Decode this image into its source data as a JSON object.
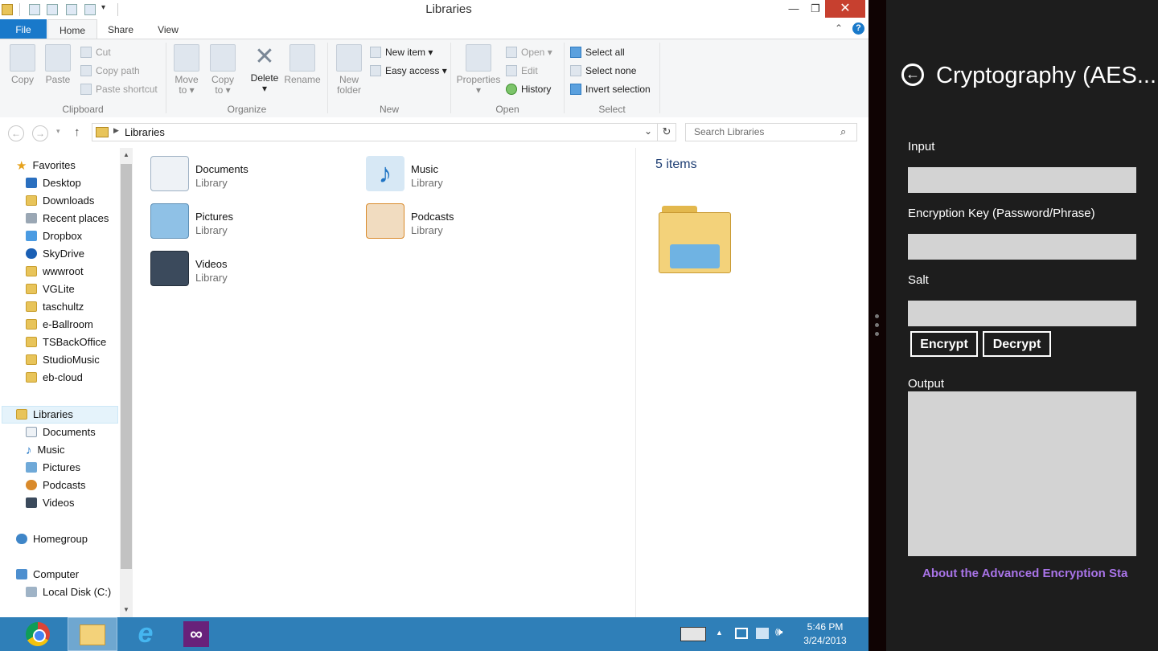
{
  "window": {
    "title": "Libraries",
    "controls": {
      "minimize": "—",
      "maximize": "❐",
      "close": "✕"
    }
  },
  "ribbon_tabs": [
    "File",
    "Home",
    "Share",
    "View"
  ],
  "ribbon": {
    "clipboard": {
      "label": "Clipboard",
      "copy": "Copy",
      "paste": "Paste",
      "cut": "Cut",
      "copy_path": "Copy path",
      "paste_shortcut": "Paste shortcut"
    },
    "organize": {
      "label": "Organize",
      "move_to": "Move",
      "move_to_2": "to ▾",
      "copy_to": "Copy",
      "copy_to_2": "to ▾",
      "delete": "Delete",
      "delete_2": "▾",
      "rename": "Rename"
    },
    "new": {
      "label": "New",
      "new_folder": "New",
      "new_folder_2": "folder",
      "new_item": "New item ▾",
      "easy_access": "Easy access ▾"
    },
    "open": {
      "label": "Open",
      "properties": "Properties",
      "properties_2": "▾",
      "open": "Open ▾",
      "edit": "Edit",
      "history": "History"
    },
    "select": {
      "label": "Select",
      "select_all": "Select all",
      "select_none": "Select none",
      "invert": "Invert selection"
    }
  },
  "address": {
    "path": "Libraries",
    "search_placeholder": "Search Libraries"
  },
  "nav": {
    "favorites": "Favorites",
    "favorite_items": [
      "Desktop",
      "Downloads",
      "Recent places",
      "Dropbox",
      "SkyDrive",
      "wwwroot",
      "VGLite",
      "taschultz",
      "e-Ballroom",
      "TSBackOffice",
      "StudioMusic",
      "eb-cloud"
    ],
    "libraries": "Libraries",
    "library_items": [
      "Documents",
      "Music",
      "Pictures",
      "Podcasts",
      "Videos"
    ],
    "homegroup": "Homegroup",
    "computer": "Computer",
    "computer_items": [
      "Local Disk (C:)"
    ]
  },
  "content": {
    "items": [
      {
        "name": "Documents",
        "type": "Library"
      },
      {
        "name": "Music",
        "type": "Library"
      },
      {
        "name": "Pictures",
        "type": "Library"
      },
      {
        "name": "Podcasts",
        "type": "Library"
      },
      {
        "name": "Videos",
        "type": "Library"
      }
    ],
    "count": "5 items"
  },
  "taskbar": {
    "time": "5:46 PM",
    "date": "3/24/2013",
    "tray_arrow": "▲"
  },
  "app": {
    "title": "Cryptography (AES...",
    "input_label": "Input",
    "key_label": "Encryption Key (Password/Phrase)",
    "salt_label": "Salt",
    "encrypt": "Encrypt",
    "decrypt": "Decrypt",
    "output_label": "Output",
    "about_link": "About the Advanced Encryption Sta",
    "link_color": "#a974e8"
  }
}
